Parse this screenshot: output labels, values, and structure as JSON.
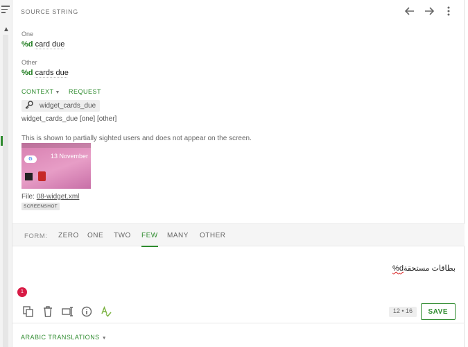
{
  "header": {
    "title": "SOURCE STRING"
  },
  "source": {
    "one": {
      "label": "One",
      "placeholder": "%d",
      "text": "card due"
    },
    "other": {
      "label": "Other",
      "placeholder": "%d",
      "text": "cards due"
    }
  },
  "context": {
    "context_label": "CONTEXT",
    "request_label": "REQUEST"
  },
  "key": {
    "name": "widget_cards_due",
    "forms": "widget_cards_due [one] [other]"
  },
  "description": "This is shown to partially sighted users and does not appear on the screen.",
  "screenshot": {
    "date": "13 November",
    "file_label": "File:",
    "file_name": "08-widget.xml",
    "badge": "SCREENSHOT"
  },
  "forms": {
    "label": "FORM:",
    "tabs": [
      {
        "label": "ZERO",
        "active": false
      },
      {
        "label": "ONE",
        "active": false
      },
      {
        "label": "TWO",
        "active": false
      },
      {
        "label": "FEW",
        "active": true
      },
      {
        "label": "MANY",
        "active": false
      },
      {
        "label": "OTHER",
        "active": false
      }
    ]
  },
  "translation": {
    "placeholder": "d%",
    "text": "بطاقات مستحقة"
  },
  "error_count": "1",
  "counter": "12 • 16",
  "save_label": "SAVE",
  "footer": {
    "label": "ARABIC TRANSLATIONS"
  },
  "colors": {
    "accent": "#2e8b2e",
    "error": "#d81b45"
  }
}
